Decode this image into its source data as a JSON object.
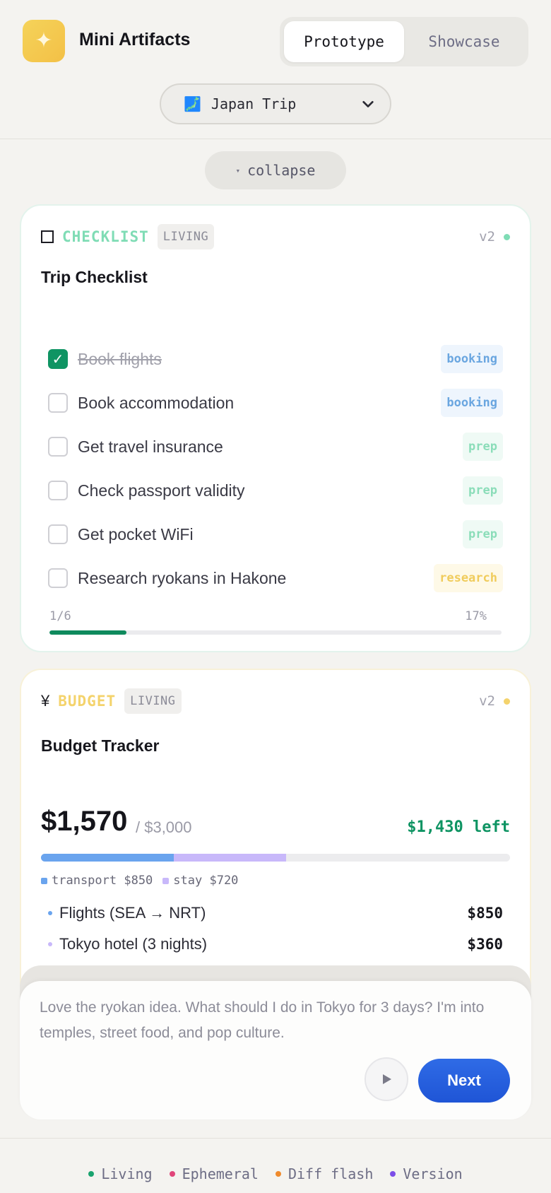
{
  "app": {
    "title": "Mini Artifacts",
    "logo_glyph": "✦",
    "modes": [
      "Prototype",
      "Showcase"
    ],
    "active_mode": "Prototype"
  },
  "project": {
    "flag_glyph": "🗾",
    "name": "Japan Trip",
    "icon": "chevron-down-icon"
  },
  "collapse": {
    "arrow": "▾",
    "label": "collapse"
  },
  "checklist_card": {
    "kind": "CHECKLIST",
    "status_tag": "LIVING",
    "version": "v2",
    "accent": "#7fdcb5",
    "title": "Trip Checklist",
    "items": [
      {
        "label": "Book flights",
        "tag": "booking",
        "done": true
      },
      {
        "label": "Book accommodation",
        "tag": "booking",
        "done": false
      },
      {
        "label": "Get travel insurance",
        "tag": "prep",
        "done": false
      },
      {
        "label": "Check passport validity",
        "tag": "prep",
        "done": false
      },
      {
        "label": "Get pocket WiFi",
        "tag": "prep",
        "done": false
      },
      {
        "label": "Research ryokans in Hakone",
        "tag": "research",
        "done": false
      }
    ],
    "progress_count": "1/6",
    "progress_percent": "17%",
    "progress_value": 0.17
  },
  "budget_card": {
    "kind": "BUDGET",
    "kind_glyph": "¥",
    "status_tag": "LIVING",
    "version": "v2",
    "accent": "#f4d36c",
    "title": "Budget Tracker",
    "spent": "$1,570",
    "total": "/ $3,000",
    "remaining": "$1,430 left",
    "segments": [
      {
        "name": "transport",
        "label": "transport $850",
        "value": 850,
        "color": "#6aa4ee"
      },
      {
        "name": "stay",
        "label": "stay $720",
        "value": 720,
        "color": "#c8b8fa"
      }
    ],
    "budget_total_value": 3000,
    "expenses": [
      {
        "label": "Flights (SEA → NRT)",
        "amount": "$850",
        "color": "#6aa4ee"
      },
      {
        "label": "Tokyo hotel (3 nights)",
        "amount": "$360",
        "color": "#c8b8fa"
      }
    ]
  },
  "composer": {
    "message": "Love the ryokan idea. What should I do in Tokyo for 3 days? I'm into temples, street food, and pop culture.",
    "next_label": "Next"
  },
  "footer_legend": [
    {
      "label": "Living",
      "color": "#1aa36f"
    },
    {
      "label": "Ephemeral",
      "color": "#e0457a"
    },
    {
      "label": "Diff flash",
      "color": "#ef8a2c"
    },
    {
      "label": "Version",
      "color": "#7c4ee8"
    }
  ]
}
